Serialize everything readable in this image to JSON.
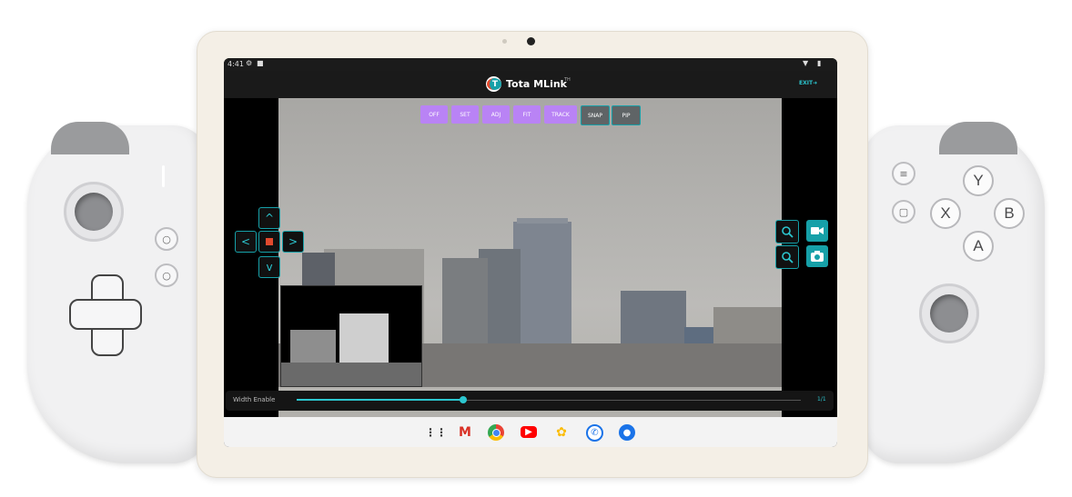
{
  "app": {
    "title": "Tota MLink",
    "title_suffix": "TH",
    "exit_label": "EXIT",
    "logo_letter": "T"
  },
  "status_bar": {
    "time": "4:41",
    "icons_left": [
      "gear-icon",
      "lock-icon"
    ],
    "icons_right": [
      "wifi-icon",
      "battery-icon"
    ]
  },
  "mode_buttons": [
    {
      "label": "OFF",
      "color": "#b983f5"
    },
    {
      "label": "SET",
      "color": "#b983f5"
    },
    {
      "label": "ADJ",
      "color": "#b983f5"
    },
    {
      "label": "FIT",
      "color": "#b983f5"
    },
    {
      "label": "TRACK",
      "color": "#b983f5"
    },
    {
      "label": "SNAP",
      "color": "#5f6466"
    },
    {
      "label": "PIP",
      "color": "#5f6466"
    }
  ],
  "ptz": {
    "up": "^",
    "left": "<",
    "right": ">",
    "down": "v"
  },
  "slider": {
    "label": "Width Enable",
    "value_label": "1/1",
    "value_fraction": 0.33
  },
  "dock_icons": [
    "apps-icon",
    "gmail-icon",
    "chrome-icon",
    "youtube-icon",
    "photos-icon",
    "phone-icon",
    "messages-icon"
  ],
  "controller": {
    "face_y": "Y",
    "face_x": "X",
    "face_b": "B",
    "face_a": "A"
  },
  "colors": {
    "accent": "#16a0a8",
    "mode_active": "#b983f5",
    "mode_inactive": "#5f6466",
    "stop": "#e24a2e"
  }
}
